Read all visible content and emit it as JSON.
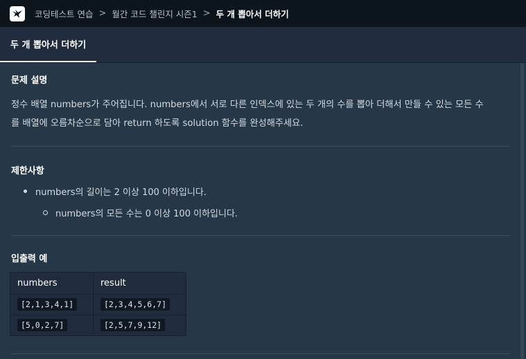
{
  "breadcrumb": {
    "items": [
      "코딩테스트 연습",
      "월간 코드 챌린지 시즌1"
    ],
    "current": "두 개 뽑아서 더하기",
    "separator": ">"
  },
  "tab": {
    "label": "두 개 뽑아서 더하기"
  },
  "problem": {
    "heading": "문제 설명",
    "line1": "정수 배열 numbers가 주어집니다. numbers에서 서로 다른 인덱스에 있는 두 개의 수를 뽑아 더해서 만들 수 있는 모든 수",
    "line2": "를 배열에 오름차순으로 담아 return 하도록 solution 함수를 완성해주세요."
  },
  "constraints": {
    "heading": "제한사항",
    "items": [
      "numbers의 길이는 2 이상 100 이하입니다.",
      "numbers의 모든 수는 0 이상 100 이하입니다."
    ]
  },
  "examples": {
    "heading": "입출력 예",
    "columns": [
      "numbers",
      "result"
    ],
    "rows": [
      [
        "[2,1,3,4,1]",
        "[2,3,4,5,6,7]"
      ],
      [
        "[5,0,2,7]",
        "[2,5,7,9,12]"
      ]
    ]
  },
  "colors": {
    "topbar": "#0c151c",
    "tabbar": "#202b3d",
    "background": "#263747",
    "text": "#d4dbe2"
  },
  "icons": {
    "logo": "programmers-logo-icon",
    "separator": "chevron-right-icon"
  }
}
